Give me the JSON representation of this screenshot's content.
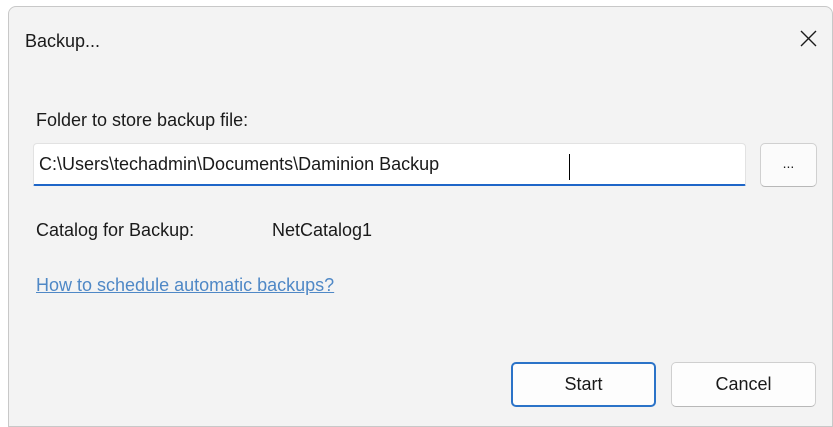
{
  "dialog": {
    "title": "Backup...",
    "close_icon": "close-icon"
  },
  "folder": {
    "label": "Folder to store backup file:",
    "value": "C:\\Users\\techadmin\\Documents\\Daminion Backup",
    "browse_label": "..."
  },
  "catalog": {
    "label": "Catalog for Backup:",
    "value": "NetCatalog1"
  },
  "help_link": {
    "text": "How to schedule automatic backups?"
  },
  "buttons": {
    "start_label": "Start",
    "cancel_label": "Cancel"
  },
  "colors": {
    "accent": "#1e66c8",
    "link": "#4f88c6",
    "dialog_bg": "#f3f3f3"
  }
}
